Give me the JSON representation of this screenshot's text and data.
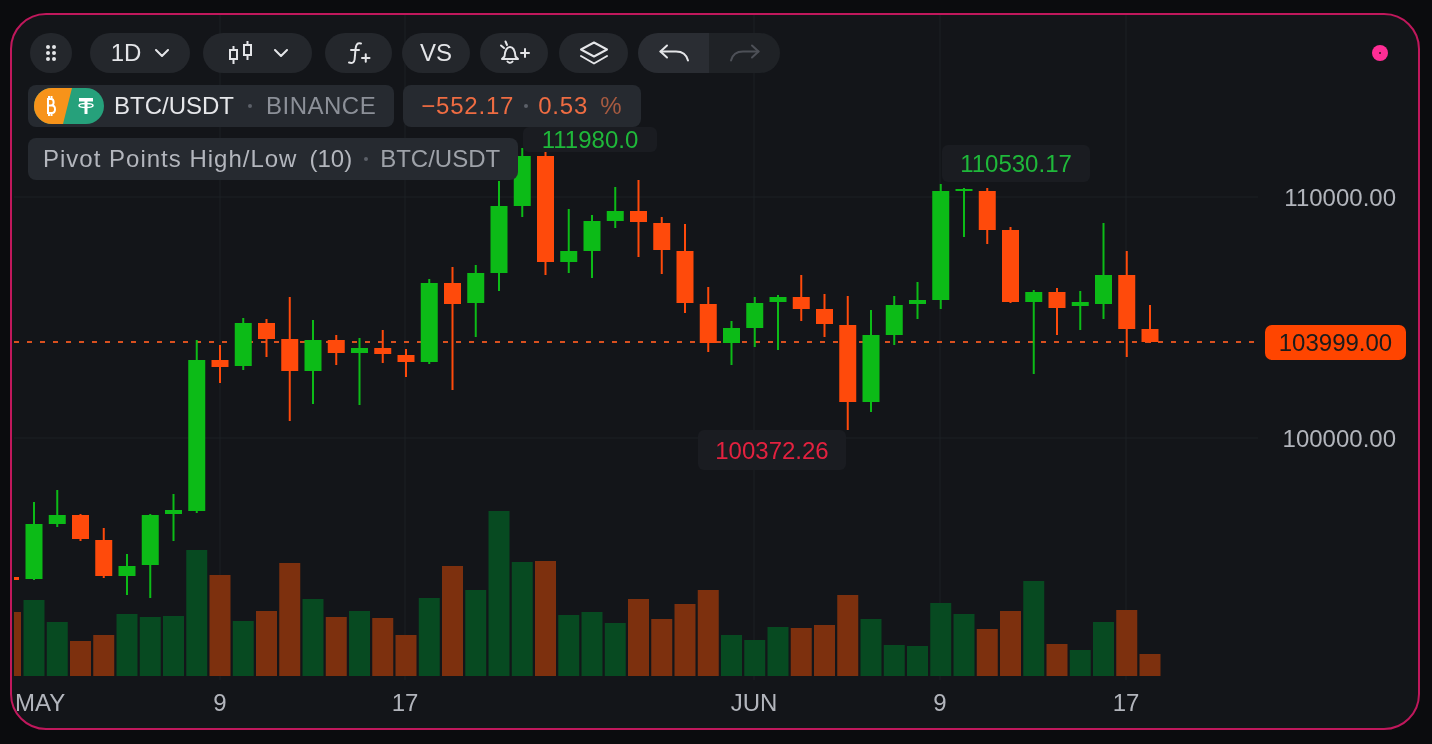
{
  "toolbar": {
    "buttons": [
      {
        "kind": "grip"
      },
      {
        "kind": "interval",
        "label": "1D"
      },
      {
        "kind": "chart-style"
      },
      {
        "kind": "indicators"
      },
      {
        "kind": "compare",
        "label": "VS"
      },
      {
        "kind": "alert"
      },
      {
        "kind": "layers"
      }
    ],
    "history": [
      {
        "kind": "undo",
        "disabled": false
      },
      {
        "kind": "redo",
        "disabled": true
      }
    ]
  },
  "legend": {
    "symbol": "BTC/USDT",
    "exchange": "BINANCE",
    "change": {
      "value": "−552.17",
      "percent": "0.53",
      "unit": "%",
      "negative": true
    }
  },
  "indicator": {
    "name": "Pivot Points High/Low",
    "length": "(10)",
    "symbol": "BTC/USDT"
  },
  "chart": {
    "price_axis": [
      "110000.00",
      "100000.00"
    ],
    "current_price": "103999.00",
    "pivots": [
      {
        "kind": "high",
        "label": "111980.0"
      },
      {
        "kind": "high",
        "label": "110530.17"
      },
      {
        "kind": "low",
        "label": "100372.26"
      }
    ],
    "time_axis": [
      "MAY",
      "9",
      "17",
      "JUN",
      "9",
      "17"
    ]
  }
}
